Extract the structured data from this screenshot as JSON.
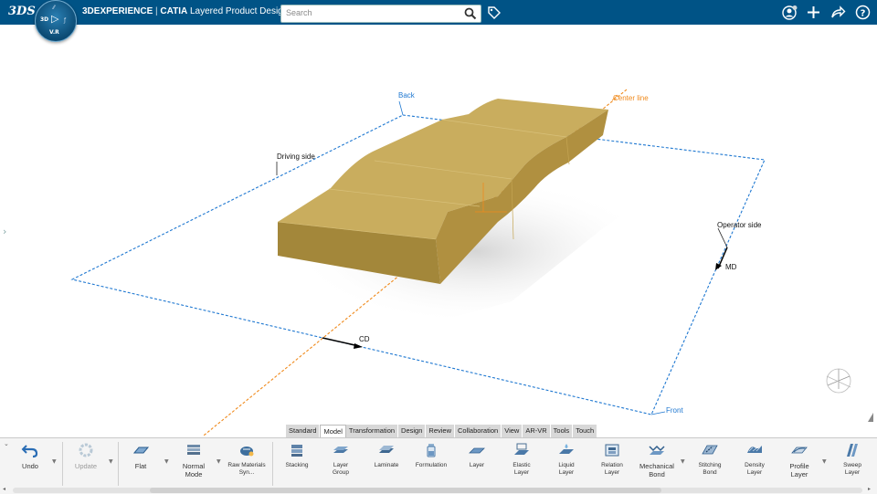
{
  "app": {
    "brand_logo": "3DS",
    "title_brand": "3DEXPERIENCE",
    "title_sep": " | ",
    "title_product": "CATIA",
    "title_app": "Layered Product Design",
    "compass_3d": "3D",
    "compass_version": "V.R",
    "compass_top": "⁄⁄",
    "compass_right": "ƒ"
  },
  "search": {
    "placeholder": "Search",
    "value": ""
  },
  "icons": {
    "search": "search-icon",
    "tag": "tag-icon",
    "user": "user-icon",
    "add": "plus-icon",
    "share": "share-icon",
    "help": "help-icon"
  },
  "viewport_labels": {
    "back": "Back",
    "center_line": "Center line",
    "driving_side": "Driving side",
    "operator_side": "Operator side",
    "md": "MD",
    "cd": "CD",
    "front": "Front"
  },
  "colors": {
    "topbar": "#005386",
    "frame_line": "#1f78d1",
    "center_line": "#f08a1c",
    "part_top": "#c9ad5e",
    "part_side": "#b09040",
    "part_front": "#a3873a"
  },
  "tabs": [
    {
      "label": "Standard",
      "active": false
    },
    {
      "label": "Model",
      "active": true
    },
    {
      "label": "Transformation",
      "active": false
    },
    {
      "label": "Design",
      "active": false
    },
    {
      "label": "Review",
      "active": false
    },
    {
      "label": "Collaboration",
      "active": false
    },
    {
      "label": "View",
      "active": false
    },
    {
      "label": "AR-VR",
      "active": false
    },
    {
      "label": "Tools",
      "active": false
    },
    {
      "label": "Touch",
      "active": false
    }
  ],
  "actions": {
    "undo": "Undo",
    "update": "Update",
    "flat": "Flat",
    "normal_mode": "Normal Mode",
    "raw_materials": "Raw Materials Syn...",
    "stacking": "Stacking",
    "layer_group": "Layer Group",
    "laminate": "Laminate",
    "formulation": "Formulation",
    "layer": "Layer",
    "elastic_layer": "Elastic Layer",
    "liquid_layer": "Liquid Layer",
    "relation_layer": "Relation Layer",
    "mechanical_bond": "Mechanical Bond",
    "stitching_bond": "Stitching Bond",
    "density_layer": "Density Layer",
    "profile_layer": "Profile Layer",
    "sweep_layer": "Sweep Layer"
  }
}
